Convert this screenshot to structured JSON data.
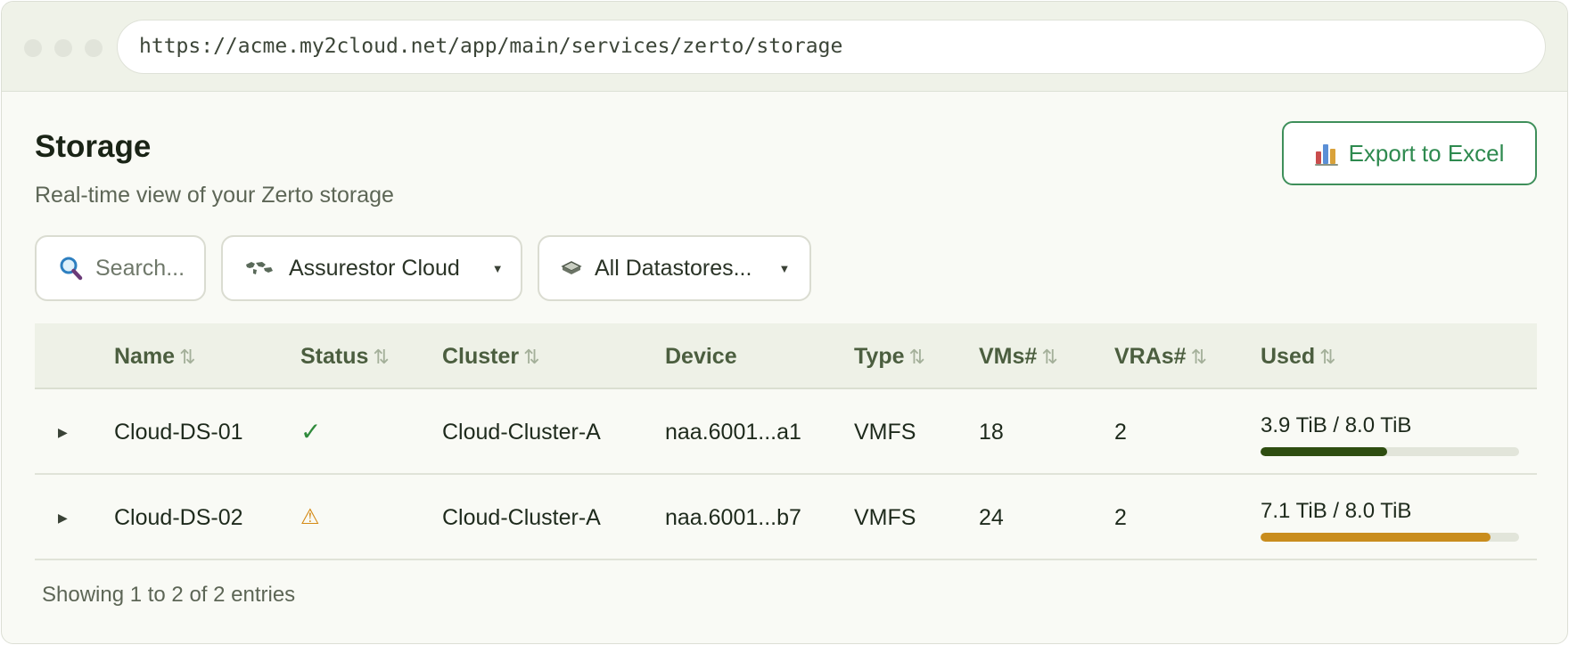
{
  "browser": {
    "url": "https://acme.my2cloud.net/app/main/services/zerto/storage"
  },
  "page": {
    "title": "Storage",
    "subtitle": "Real-time view of your Zerto storage"
  },
  "toolbar": {
    "export_label": "Export to Excel",
    "export_icon": "excel-chart-icon"
  },
  "filters": {
    "search_placeholder": "Search...",
    "search_icon": "search-icon",
    "site_value": "Assurestor Cloud",
    "site_icon": "globe-map-icon",
    "datastore_value": "All Datastores...",
    "datastore_icon": "disk-stack-icon"
  },
  "table": {
    "columns": [
      "Name",
      "Status",
      "Cluster",
      "Device",
      "Type",
      "VMs#",
      "VRAs#",
      "Used"
    ],
    "sort_icon": "⇅",
    "rows": [
      {
        "name": "Cloud-DS-01",
        "status": "ok",
        "status_glyph": "✓",
        "status_color": "#2f8a3b",
        "cluster": "Cloud-Cluster-A",
        "device": "naa.6001...a1",
        "type": "VMFS",
        "vms": "18",
        "vras": "2",
        "used_label": "3.9 TiB / 8.0 TiB",
        "used_fraction": 0.49,
        "bar_color": "#2e4d10"
      },
      {
        "name": "Cloud-DS-02",
        "status": "warning",
        "status_glyph": "⚠",
        "status_color": "#d48a16",
        "cluster": "Cloud-Cluster-A",
        "device": "naa.6001...b7",
        "type": "VMFS",
        "vms": "24",
        "vras": "2",
        "used_label": "7.1 TiB / 8.0 TiB",
        "used_fraction": 0.89,
        "bar_color": "#c98d1e"
      }
    ]
  },
  "footer": {
    "info": "Showing 1 to 2 of 2 entries"
  }
}
